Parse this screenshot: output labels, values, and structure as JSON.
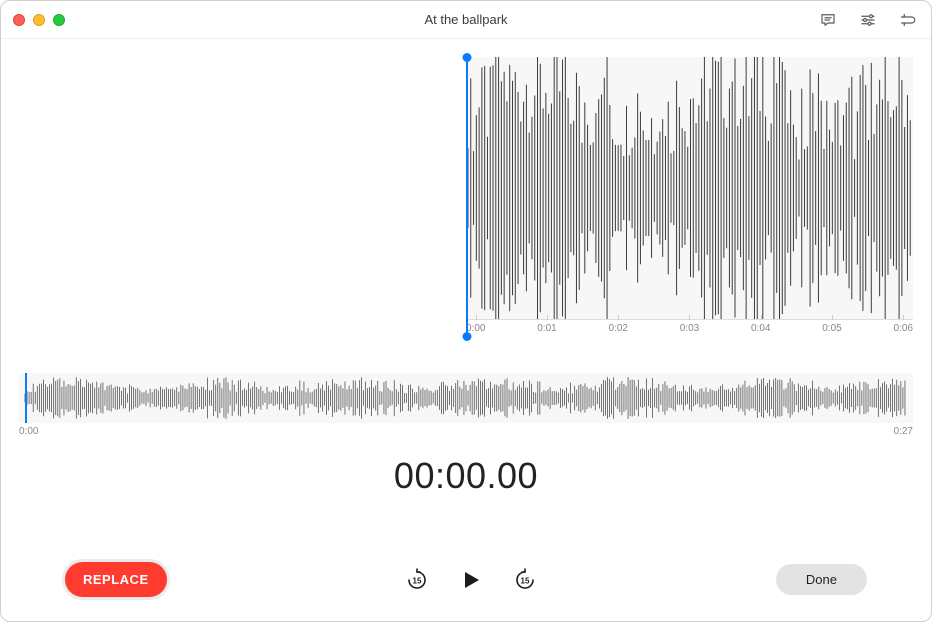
{
  "window": {
    "title": "At the ballpark"
  },
  "toolbar_icons": {
    "transcript": "transcript-icon",
    "settings": "settings-icon",
    "trim": "trim-icon"
  },
  "zoom_timeline": {
    "ticks": [
      "0:00",
      "0:01",
      "0:02",
      "0:03",
      "0:04",
      "0:05",
      "0:06"
    ]
  },
  "overview": {
    "start_label": "0:00",
    "end_label": "0:27"
  },
  "timecode": "00:00.00",
  "controls": {
    "replace_label": "REPLACE",
    "skip_back_seconds": "15",
    "skip_forward_seconds": "15",
    "done_label": "Done"
  },
  "colors": {
    "accent": "#0a7bff",
    "record_red": "#ff3b30",
    "waveform": "#3a3a3a",
    "wave_bg": "#f7f7f7"
  }
}
